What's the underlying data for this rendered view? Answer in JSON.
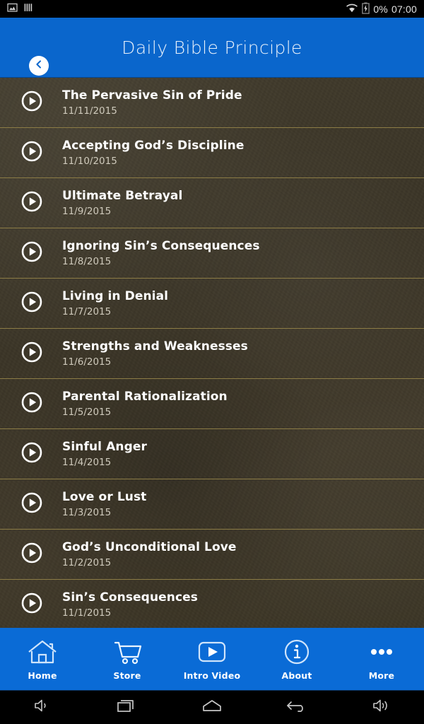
{
  "status_bar": {
    "left_icons": [
      {
        "name": "screenshot-icon",
        "label": "screenshot"
      },
      {
        "name": "equalizer-bars-icon",
        "label": "bars"
      }
    ],
    "wifi_icon": "wifi-icon",
    "battery_icon": "battery-charging-icon",
    "battery_percent": "0%",
    "clock": "07:00"
  },
  "app_bar": {
    "back_icon": "chevron-left-icon",
    "title": "Daily Bible Principle",
    "background_color": "#0a66cc"
  },
  "list": {
    "play_icon": "play-circle-icon",
    "divider_color": "#8c7c46",
    "items": [
      {
        "title": "The Pervasive Sin of Pride",
        "date": "11/11/2015"
      },
      {
        "title": "Accepting God’s Discipline",
        "date": "11/10/2015"
      },
      {
        "title": "Ultimate Betrayal",
        "date": "11/9/2015"
      },
      {
        "title": "Ignoring Sin’s Consequences",
        "date": "11/8/2015"
      },
      {
        "title": "Living in Denial",
        "date": "11/7/2015"
      },
      {
        "title": "Strengths and Weaknesses",
        "date": "11/6/2015"
      },
      {
        "title": "Parental Rationalization",
        "date": "11/5/2015"
      },
      {
        "title": "Sinful Anger",
        "date": "11/4/2015"
      },
      {
        "title": "Love or Lust",
        "date": "11/3/2015"
      },
      {
        "title": "God’s Unconditional Love",
        "date": "11/2/2015"
      },
      {
        "title": "Sin’s Consequences",
        "date": "11/1/2015"
      }
    ]
  },
  "bottom_nav": {
    "background_color": "#0a6bd6",
    "items": [
      {
        "label": "Home",
        "icon": "home-icon"
      },
      {
        "label": "Store",
        "icon": "shopping-cart-icon"
      },
      {
        "label": "Intro Video",
        "icon": "video-play-icon"
      },
      {
        "label": "About",
        "icon": "info-circle-icon"
      },
      {
        "label": "More",
        "icon": "ellipsis-icon"
      }
    ]
  },
  "system_nav": {
    "buttons": [
      {
        "name": "volume-down-icon"
      },
      {
        "name": "recents-icon"
      },
      {
        "name": "home-icon"
      },
      {
        "name": "back-icon"
      },
      {
        "name": "volume-up-icon"
      }
    ]
  }
}
